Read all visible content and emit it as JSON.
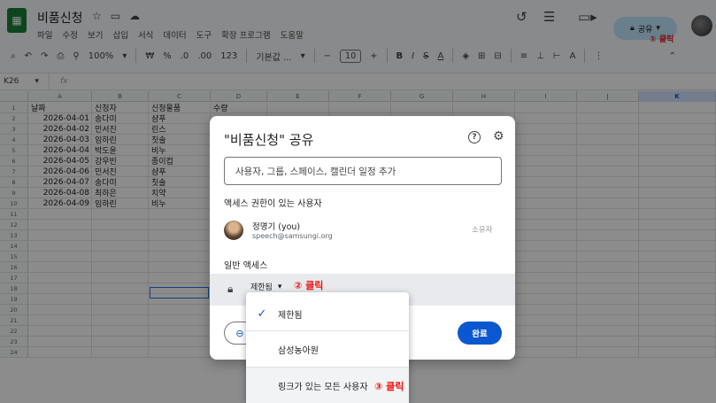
{
  "app": {
    "icon": "sheets-icon",
    "title": "비품신청",
    "menu": [
      "파일",
      "수정",
      "보기",
      "삽입",
      "서식",
      "데이터",
      "도구",
      "확장 프로그램",
      "도움말"
    ],
    "share_label": "공유",
    "annot_1": "① 클릭"
  },
  "toolbar": {
    "zoom": "100%",
    "currency": "₩",
    "percent": "%",
    "dec_decrease": ".0",
    "dec_increase": ".00",
    "number_format": "123",
    "font": "기본값 ...",
    "font_size": "10"
  },
  "formula_bar": {
    "cell_ref": "K26",
    "fx": "fx"
  },
  "grid": {
    "columns": [
      "A",
      "B",
      "C",
      "D",
      "E",
      "F",
      "G",
      "H",
      "I",
      "J",
      "K"
    ],
    "selected_column": "K",
    "row_numbers": [
      "1",
      "2",
      "3",
      "4",
      "5",
      "6",
      "7",
      "8",
      "9",
      "10",
      "11",
      "12",
      "13",
      "14",
      "15",
      "16",
      "17",
      "18",
      "19",
      "20",
      "21",
      "22",
      "23",
      "24"
    ],
    "rows": [
      [
        "날짜",
        "신청자",
        "신청물품",
        "수량"
      ],
      [
        "2026-04-01",
        "송다미",
        "샴푸",
        ""
      ],
      [
        "2026-04-02",
        "민서진",
        "린스",
        ""
      ],
      [
        "2026-04-03",
        "임하린",
        "칫솔",
        ""
      ],
      [
        "2026-04-04",
        "박도윤",
        "비누",
        ""
      ],
      [
        "2026-04-05",
        "강우빈",
        "종이컵",
        ""
      ],
      [
        "2026-04-06",
        "민서진",
        "샴푸",
        ""
      ],
      [
        "2026-04-07",
        "송다미",
        "칫솔",
        ""
      ],
      [
        "2026-04-08",
        "최하은",
        "치약",
        ""
      ],
      [
        "2026-04-09",
        "임하린",
        "비누",
        ""
      ]
    ]
  },
  "dialog": {
    "title": "\"비품신청\" 공유",
    "add_placeholder": "사용자, 그룹, 스페이스, 캘린더 일정 추가",
    "people_section": "액세스 권한이 있는 사용자",
    "person": {
      "name": "정명기 (you)",
      "email": "speech@samsungi.org",
      "role": "소유자"
    },
    "general_section": "일반 액세스",
    "general_value": "제한됨",
    "annot_2": "② 클릭",
    "done_label": "완료"
  },
  "menu": {
    "items": [
      {
        "label": "제한됨",
        "checked": true
      },
      {
        "label": "삼성농아원",
        "checked": false
      },
      {
        "label": "링크가 있는 모든 사용자",
        "checked": false
      }
    ],
    "annot_3": "③ 클릭"
  },
  "colors": {
    "accent": "#0b57d0",
    "annotation": "#ee1111",
    "share_button": "#c2e7ff"
  }
}
